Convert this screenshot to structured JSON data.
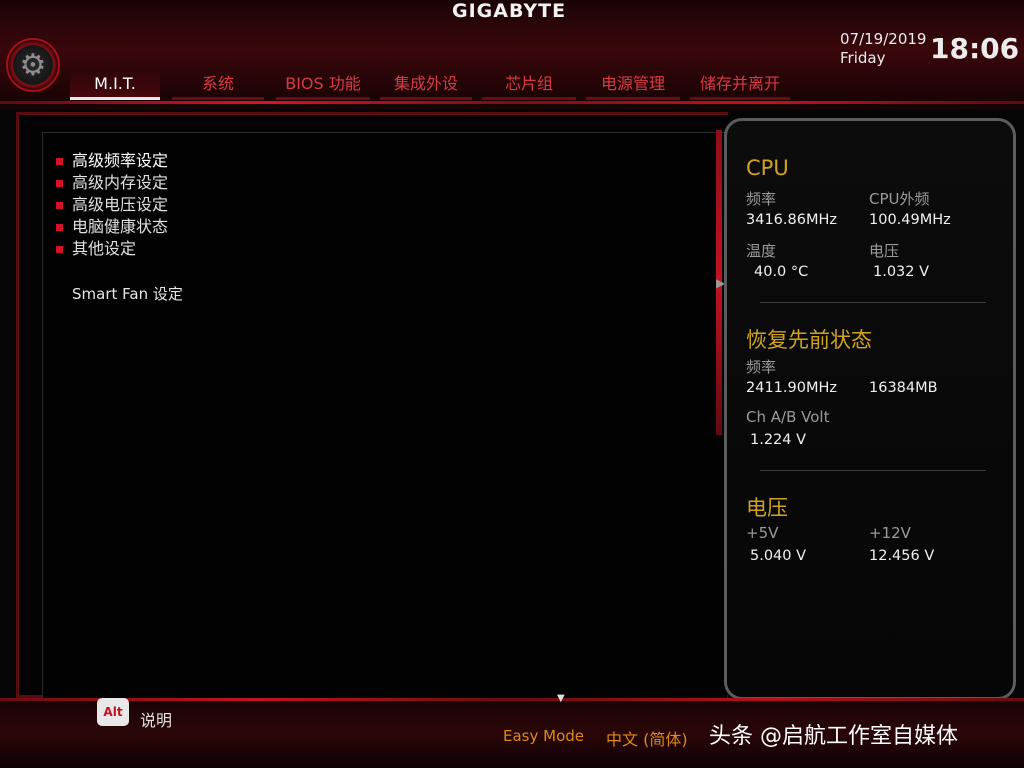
{
  "header": {
    "brand": "GIGABYTE",
    "date": "07/19/2019",
    "day": "Friday",
    "time": "18:06",
    "tabs": [
      {
        "label": "M.I.T.",
        "active": true
      },
      {
        "label": "系统"
      },
      {
        "label": "BIOS 功能"
      },
      {
        "label": "集成外设"
      },
      {
        "label": "芯片组"
      },
      {
        "label": "电源管理"
      },
      {
        "label": "储存并离开"
      }
    ]
  },
  "menu": {
    "items": [
      {
        "label": "高级频率设定",
        "active": true
      },
      {
        "label": "高级内存设定"
      },
      {
        "label": "高级电压设定"
      },
      {
        "label": "电脑健康状态"
      },
      {
        "label": "其他设定"
      }
    ],
    "smart_fan": "Smart Fan 设定"
  },
  "side": {
    "cpu": {
      "title": "CPU",
      "freq_label": "频率",
      "freq_value": "3416.86MHz",
      "bclk_label": "CPU外频",
      "bclk_value": "100.49MHz",
      "temp_label": "温度",
      "temp_value": "40.0 °C",
      "volt_label": "电压",
      "volt_value": "1.032 V"
    },
    "memory": {
      "title": "恢复先前状态",
      "freq_label": "频率",
      "freq_value": "2411.90MHz",
      "size_value": "16384MB",
      "volt_label": "Ch A/B Volt",
      "volt_value": "1.224 V"
    },
    "voltage": {
      "title": "电压",
      "v5_label": "+5V",
      "v5_value": "5.040 V",
      "v12_label": "+12V",
      "v12_value": "12.456 V"
    }
  },
  "footer": {
    "alt_key": "Alt",
    "help_label": "说明",
    "easy_mode": "Easy Mode",
    "language": "中文 (简体)",
    "watermark": "头条 @启航工作室自媒体"
  },
  "colors": {
    "accent_red": "#c3121f",
    "title_gold": "#d2a41d",
    "footer_orange": "#e0891a"
  }
}
